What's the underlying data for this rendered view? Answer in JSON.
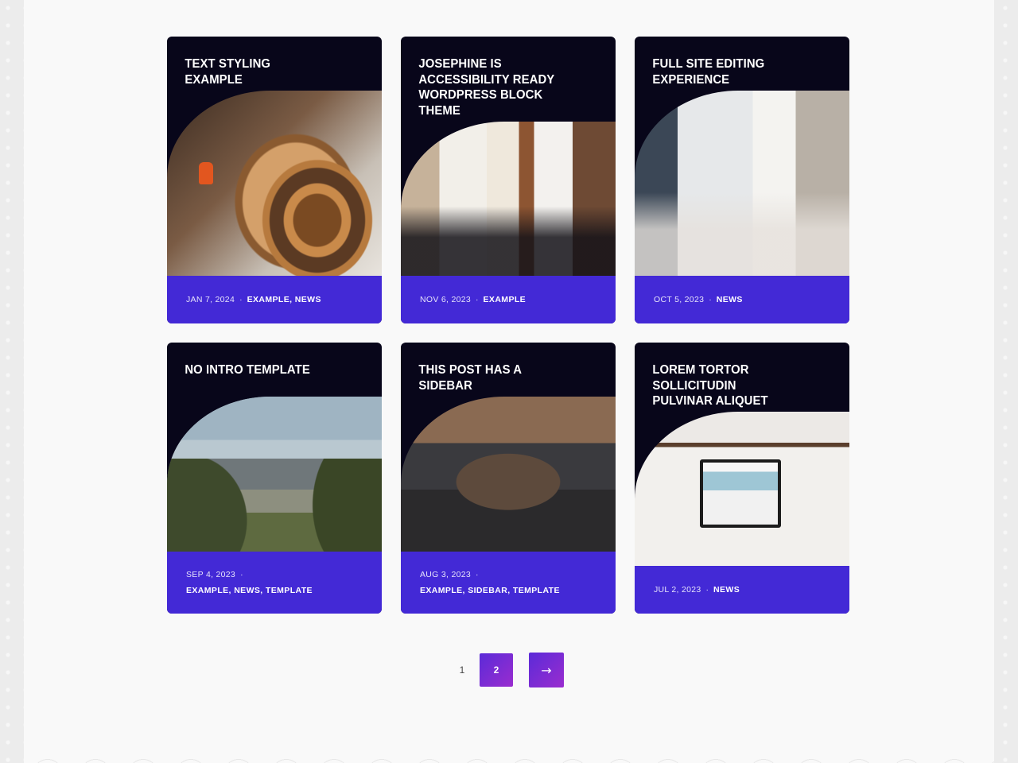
{
  "posts": [
    {
      "title": "TEXT STYLING EXAMPLE",
      "date": "JAN 7, 2024",
      "categories": "EXAMPLE, NEWS",
      "image_icon": "photo-spiral-staircase"
    },
    {
      "title": "JOSEPHINE IS ACCESSIBILITY READY WORDPRESS BLOCK THEME",
      "date": "NOV 6, 2023",
      "categories": "EXAMPLE",
      "image_icon": "photo-team-meeting"
    },
    {
      "title": "FULL SITE EDITING EXPERIENCE",
      "date": "OCT 5, 2023",
      "categories": "NEWS",
      "image_icon": "photo-men-at-laptops"
    },
    {
      "title": "NO INTRO TEMPLATE",
      "date": "SEP 4, 2023",
      "categories": "EXAMPLE, NEWS, TEMPLATE",
      "image_icon": "photo-city-skyline"
    },
    {
      "title": "THIS POST HAS A SIDEBAR",
      "date": "AUG 3, 2023",
      "categories": "EXAMPLE, SIDEBAR, TEMPLATE",
      "image_icon": "photo-team-laptops"
    },
    {
      "title": "LOREM TORTOR SOLLICITUDIN PULVINAR ALIQUET",
      "date": "JUL 2, 2023",
      "categories": "NEWS",
      "image_icon": "photo-desk-computer"
    }
  ],
  "meta_separator": "·",
  "pagination": {
    "prev_page": "1",
    "current_page": "2",
    "next_arrow": "→"
  },
  "colors": {
    "card_background": "#08061a",
    "meta_background": "#4329d6",
    "pagination_gradient_start": "#5b2bd8",
    "pagination_gradient_end": "#9a2ccf"
  }
}
